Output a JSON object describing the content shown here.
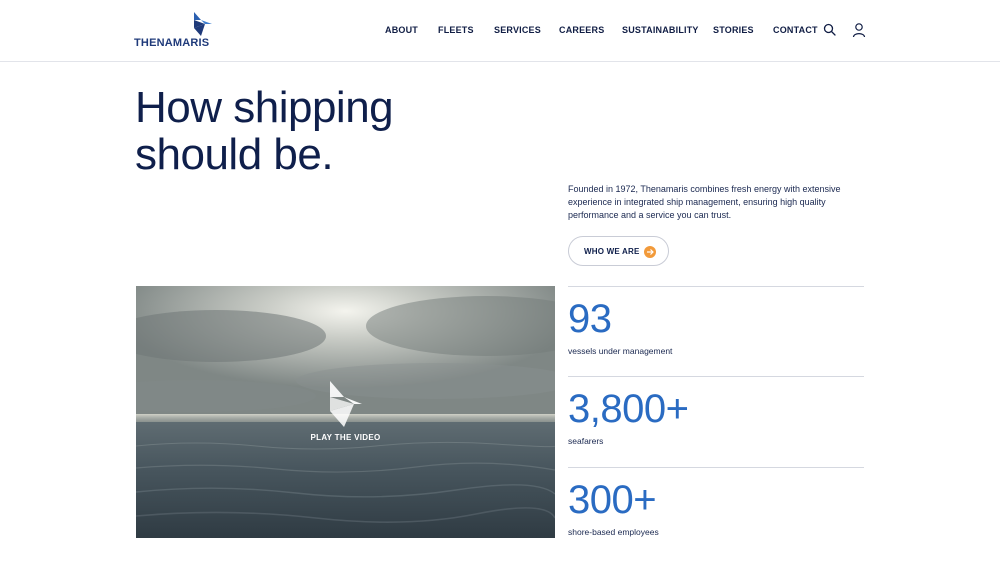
{
  "header": {
    "logo_text": "THENAMARIS",
    "nav": [
      "ABOUT",
      "FLEETS",
      "SERVICES",
      "CAREERS",
      "SUSTAINABILITY",
      "STORIES",
      "CONTACT"
    ],
    "icons": [
      "search-icon",
      "user-icon"
    ]
  },
  "hero": {
    "title_line1": "How shipping",
    "title_line2": "should be.",
    "intro": "Founded in 1972, Thenamaris combines fresh energy with extensive experience in integrated ship management, ensuring high quality performance and a service you can trust.",
    "cta_label": "WHO WE ARE"
  },
  "video": {
    "label": "PLAY THE VIDEO"
  },
  "stats": [
    {
      "value": "93",
      "label": "vessels under management"
    },
    {
      "value": "3,800+",
      "label": "seafarers"
    },
    {
      "value": "300+",
      "label": "shore-based employees"
    }
  ],
  "colors": {
    "navy": "#0f1f4b",
    "brand_blue": "#2a6bc2",
    "accent_orange": "#f29a3a"
  }
}
